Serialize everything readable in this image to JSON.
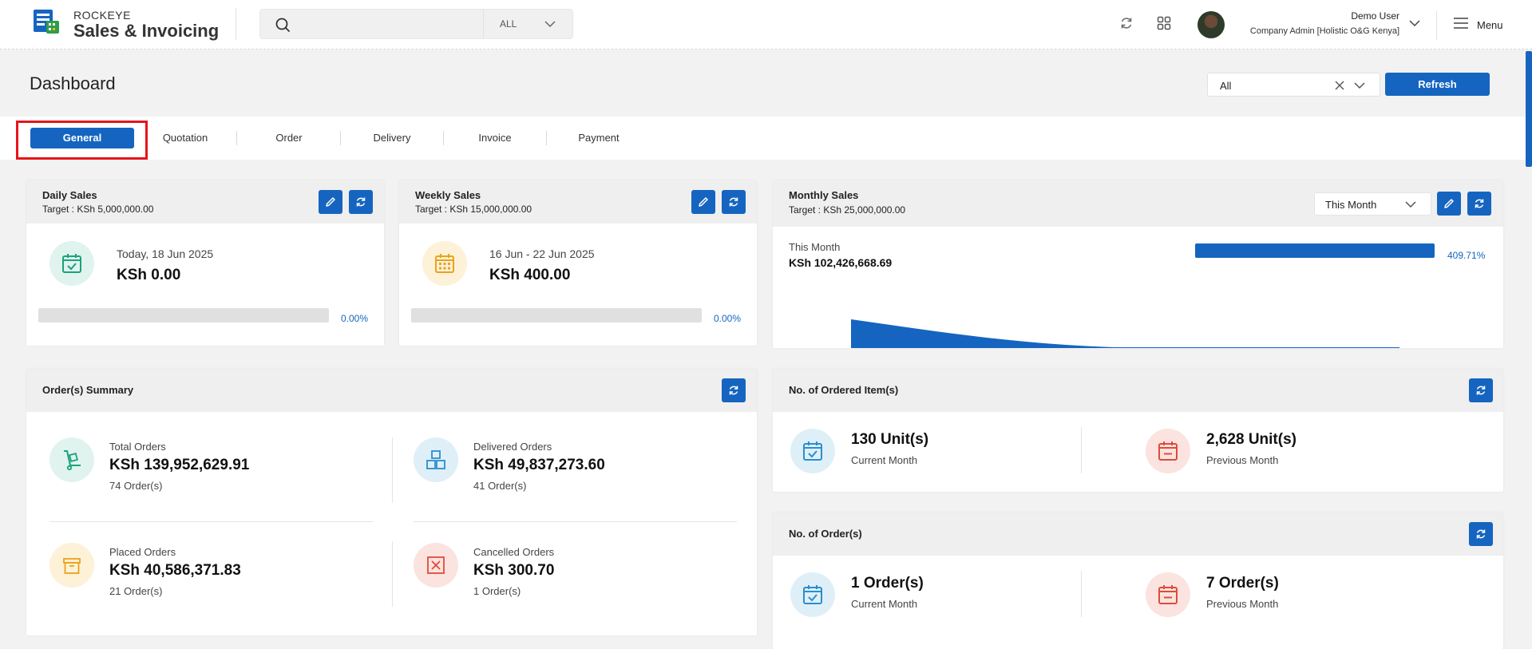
{
  "header": {
    "brand_top": "ROCKEYE",
    "brand_main": "Sales & Invoicing",
    "search_placeholder": "",
    "search_scope": "ALL",
    "user_name": "Demo User",
    "user_role": "Company Admin [Holistic O&G Kenya]",
    "menu_label": "Menu"
  },
  "page": {
    "title": "Dashboard",
    "filter_value": "All",
    "refresh_label": "Refresh"
  },
  "tabs": [
    {
      "label": "General",
      "active": true
    },
    {
      "label": "Quotation",
      "active": false
    },
    {
      "label": "Order",
      "active": false
    },
    {
      "label": "Delivery",
      "active": false
    },
    {
      "label": "Invoice",
      "active": false
    },
    {
      "label": "Payment",
      "active": false
    }
  ],
  "daily_sales": {
    "title": "Daily Sales",
    "target": "Target : KSh 5,000,000.00",
    "date": "Today, 18 Jun 2025",
    "amount": "KSh 0.00",
    "percent": "0.00%",
    "progress_fraction": 0.0
  },
  "weekly_sales": {
    "title": "Weekly Sales",
    "target": "Target : KSh 15,000,000.00",
    "date": "16 Jun - 22 Jun 2025",
    "amount": "KSh 400.00",
    "percent": "0.00%",
    "progress_fraction": 0.0
  },
  "monthly_sales": {
    "title": "Monthly Sales",
    "target": "Target : KSh 25,000,000.00",
    "period_select": "This Month",
    "period_label": "This Month",
    "amount": "KSh 102,426,668.69",
    "percent": "409.71%",
    "progress_fraction": 1.0
  },
  "orders_summary": {
    "title": "Order(s) Summary",
    "items": [
      {
        "label": "Total Orders",
        "amount": "KSh 139,952,629.91",
        "count": "74 Order(s)"
      },
      {
        "label": "Delivered Orders",
        "amount": "KSh 49,837,273.60",
        "count": "41 Order(s)"
      },
      {
        "label": "Placed Orders",
        "amount": "KSh 40,586,371.83",
        "count": "21 Order(s)"
      },
      {
        "label": "Cancelled Orders",
        "amount": "KSh 300.70",
        "count": "1 Order(s)"
      }
    ]
  },
  "ordered_items": {
    "title": "No. of Ordered Item(s)",
    "current_value": "130 Unit(s)",
    "current_label": "Current Month",
    "previous_value": "2,628 Unit(s)",
    "previous_label": "Previous Month"
  },
  "orders_count": {
    "title": "No. of Order(s)",
    "current_value": "1 Order(s)",
    "current_label": "Current Month",
    "previous_value": "7 Order(s)",
    "previous_label": "Previous Month"
  },
  "colors": {
    "accent": "#1565c0",
    "highlight": "#e8141a"
  }
}
